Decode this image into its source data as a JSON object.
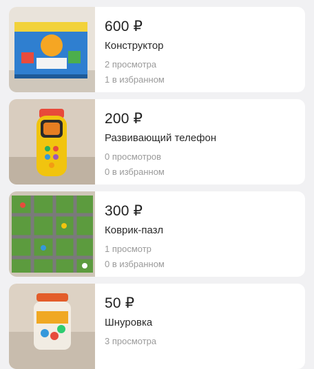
{
  "listings": [
    {
      "price": "600 ₽",
      "title": "Конструктор",
      "views": "2 просмотра",
      "favorites": "1 в избранном",
      "image_icon": "building-blocks-box-photo"
    },
    {
      "price": "200 ₽",
      "title": "Развивающий телефон",
      "views": "0 просмотров",
      "favorites": "0 в избранном",
      "image_icon": "toy-phone-photo"
    },
    {
      "price": "300 ₽",
      "title": "Коврик-пазл",
      "views": "1 просмотр",
      "favorites": "0 в избранном",
      "image_icon": "puzzle-mat-photo"
    },
    {
      "price": "50 ₽",
      "title": "Шнуровка",
      "views": "3 просмотра",
      "favorites": "",
      "image_icon": "lacing-toy-jar-photo"
    }
  ],
  "colors": {
    "background": "#f1f1f3",
    "card": "#ffffff",
    "meta_text": "#9a9a9a"
  }
}
